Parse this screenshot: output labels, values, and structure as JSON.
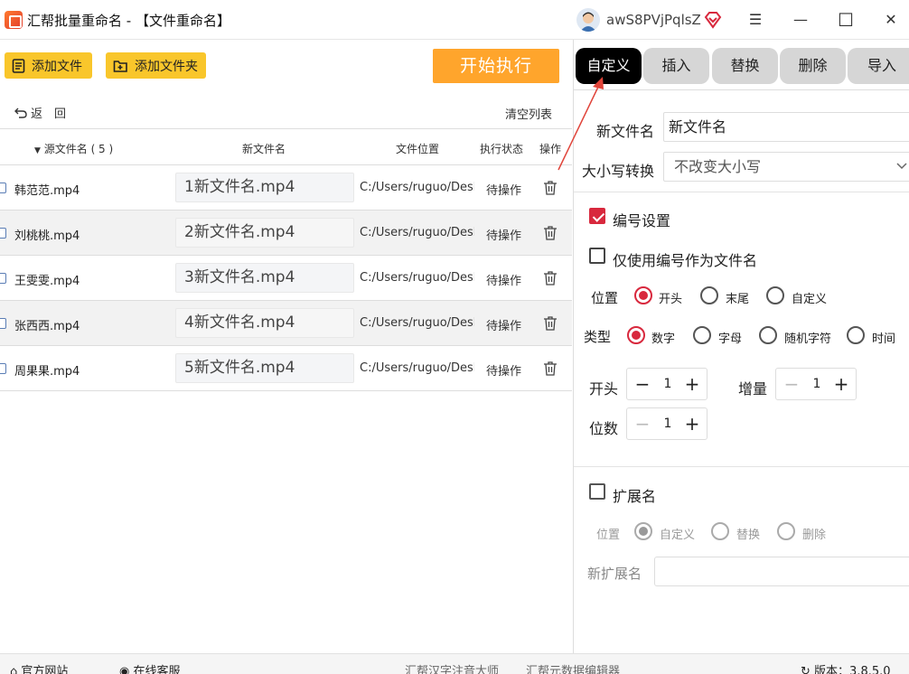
{
  "window": {
    "title": "汇帮批量重命名 - 【文件重命名】",
    "username": "awS8PVjPqlsZ",
    "controls": {
      "menu": "☰",
      "minimize": "—",
      "maximize": "☐",
      "close": "✕"
    }
  },
  "toolbar": {
    "add_file": "添加文件",
    "add_folder": "添加文件夹",
    "start": "开始执行"
  },
  "list": {
    "back": "返　回",
    "clear": "清空列表",
    "headers": {
      "source": "源文件名 ( 5 )",
      "new_name": "新文件名",
      "location": "文件位置",
      "status": "执行状态",
      "action": "操作"
    },
    "rows": [
      {
        "source": "韩范范.mp4",
        "new_name": "1新文件名.mp4",
        "path": "C:/Users/ruguo/Deskt",
        "status": "待操作"
      },
      {
        "source": "刘桃桃.mp4",
        "new_name": "2新文件名.mp4",
        "path": "C:/Users/ruguo/Deskt",
        "status": "待操作"
      },
      {
        "source": "王雯雯.mp4",
        "new_name": "3新文件名.mp4",
        "path": "C:/Users/ruguo/Deskt",
        "status": "待操作"
      },
      {
        "source": "张西西.mp4",
        "new_name": "4新文件名.mp4",
        "path": "C:/Users/ruguo/Deskt",
        "status": "待操作"
      },
      {
        "source": "周果果.mp4",
        "new_name": "5新文件名.mp4",
        "path": "C:/Users/ruguo/Deskt",
        "status": "待操作"
      }
    ]
  },
  "tabs": [
    {
      "label": "自定义",
      "active": true
    },
    {
      "label": "插入"
    },
    {
      "label": "替换"
    },
    {
      "label": "删除"
    },
    {
      "label": "导入"
    }
  ],
  "custom": {
    "new_name_label": "新文件名",
    "new_name_value": "新文件名",
    "case_label": "大小写转换",
    "case_value": "不改变大小写",
    "numbering_label": "编号设置",
    "numbering_checked": true,
    "only_number_label": "仅使用编号作为文件名",
    "only_number_checked": false,
    "position_label": "位置",
    "position_options": [
      "开头",
      "末尾",
      "自定义"
    ],
    "position_selected": "开头",
    "type_label": "类型",
    "type_options": [
      "数字",
      "字母",
      "随机字符",
      "时间"
    ],
    "type_selected": "数字",
    "start_label": "开头",
    "start_value": "1",
    "increment_label": "增量",
    "increment_value": "1",
    "digits_label": "位数",
    "digits_value": "1",
    "stepper_minus": "−",
    "stepper_plus": "+",
    "ext_label": "扩展名",
    "ext_checked": false,
    "ext_position_label": "位置",
    "ext_options": [
      "自定义",
      "替换",
      "删除"
    ],
    "ext_selected": "自定义",
    "new_ext_label": "新扩展名",
    "new_ext_value": ""
  },
  "statusbar": {
    "official_site": "官方网站",
    "online_service": "在线客服",
    "link1": "汇帮汉字注音大师",
    "link2": "汇帮元数据编辑器",
    "version": "版本：3.8.5.0"
  },
  "colors": {
    "accent": "#d8283d",
    "start_button": "#ffa52c",
    "yellow_button": "#f9c62b",
    "annotation_arrow": "#e0443a"
  }
}
